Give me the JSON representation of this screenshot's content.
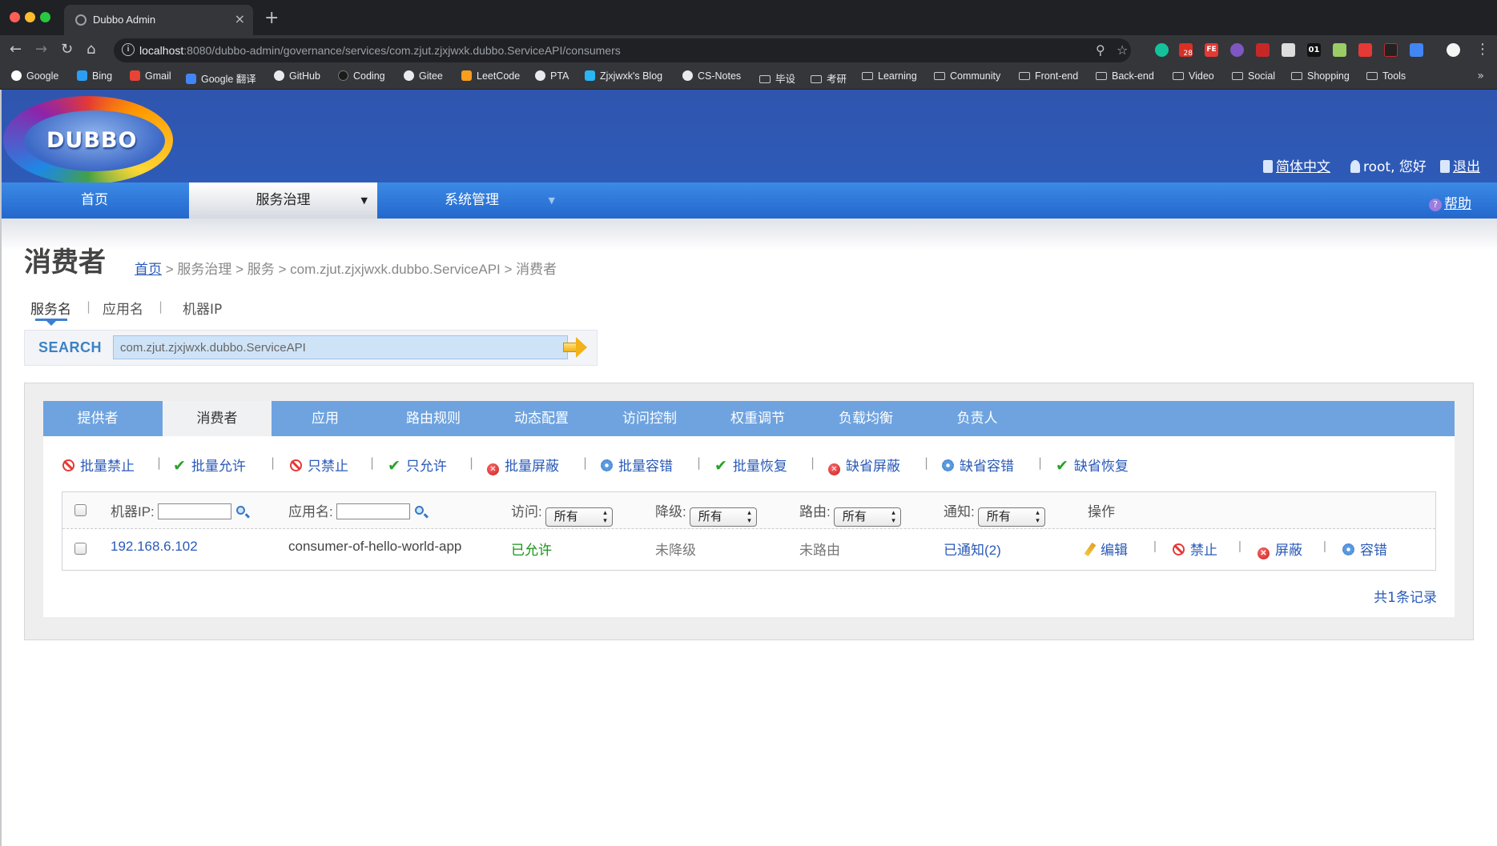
{
  "browser": {
    "tab_title": "Dubbo Admin",
    "tab_close": "×",
    "new_tab": "+",
    "url_host": "localhost",
    "url_rest": ":8080/dubbo-admin/governance/services/com.zjut.zjxjwxk.dubbo.ServiceAPI/consumers",
    "ext_badge": "28",
    "ext_fe": "FE",
    "ext_01": "01",
    "bookmarks": [
      "Google",
      "Bing",
      "Gmail",
      "Google 翻译",
      "GitHub",
      "Coding",
      "Gitee",
      "LeetCode",
      "PTA",
      "Zjxjwxk's Blog",
      "CS-Notes",
      "毕设",
      "考研",
      "Learning",
      "Community",
      "Front-end",
      "Back-end",
      "Video",
      "Social",
      "Shopping",
      "Tools"
    ],
    "bookmarks_more": "»"
  },
  "header": {
    "logo_text": "DUBBO",
    "language": "简体中文",
    "user_greeting": "root, 您好",
    "logout": "退出"
  },
  "nav": {
    "items": [
      "首页",
      "服务治理",
      "系统管理"
    ],
    "help": "帮助",
    "help_icon": "?"
  },
  "page": {
    "title": "消费者",
    "breadcrumb_home": "首页",
    "breadcrumb_rest": " > 服务治理 > 服务 > com.zjut.zjxjwxk.dubbo.ServiceAPI > 消费者"
  },
  "search": {
    "tabs": [
      "服务名",
      "应用名",
      "机器IP"
    ],
    "separator": "|",
    "label": "SEARCH",
    "value": "com.zjut.zjxjwxk.dubbo.ServiceAPI"
  },
  "subtabs": [
    "提供者",
    "消费者",
    "应用",
    "路由规则",
    "动态配置",
    "访问控制",
    "权重调节",
    "负载均衡",
    "负责人"
  ],
  "batch_actions": [
    "批量禁止",
    "批量允许",
    "只禁止",
    "只允许",
    "批量屏蔽",
    "批量容错",
    "批量恢复",
    "缺省屏蔽",
    "缺省容错",
    "缺省恢复"
  ],
  "table": {
    "headers": {
      "ip": "机器IP:",
      "app": "应用名:",
      "access": "访问:",
      "degrade": "降级:",
      "route": "路由:",
      "notify": "通知:",
      "ops": "操作"
    },
    "filter_all": "所有",
    "rows": [
      {
        "ip": "192.168.6.102",
        "app": "consumer-of-hello-world-app",
        "access": "已允许",
        "degrade": "未降级",
        "route": "未路由",
        "notify": "已通知(2)",
        "ops": [
          "编辑",
          "禁止",
          "屏蔽",
          "容错"
        ]
      }
    ],
    "total": "共1条记录"
  },
  "icon_colors": {
    "ban": "#e53935",
    "check": "#2aa22a",
    "link": "#2a5ab8"
  }
}
